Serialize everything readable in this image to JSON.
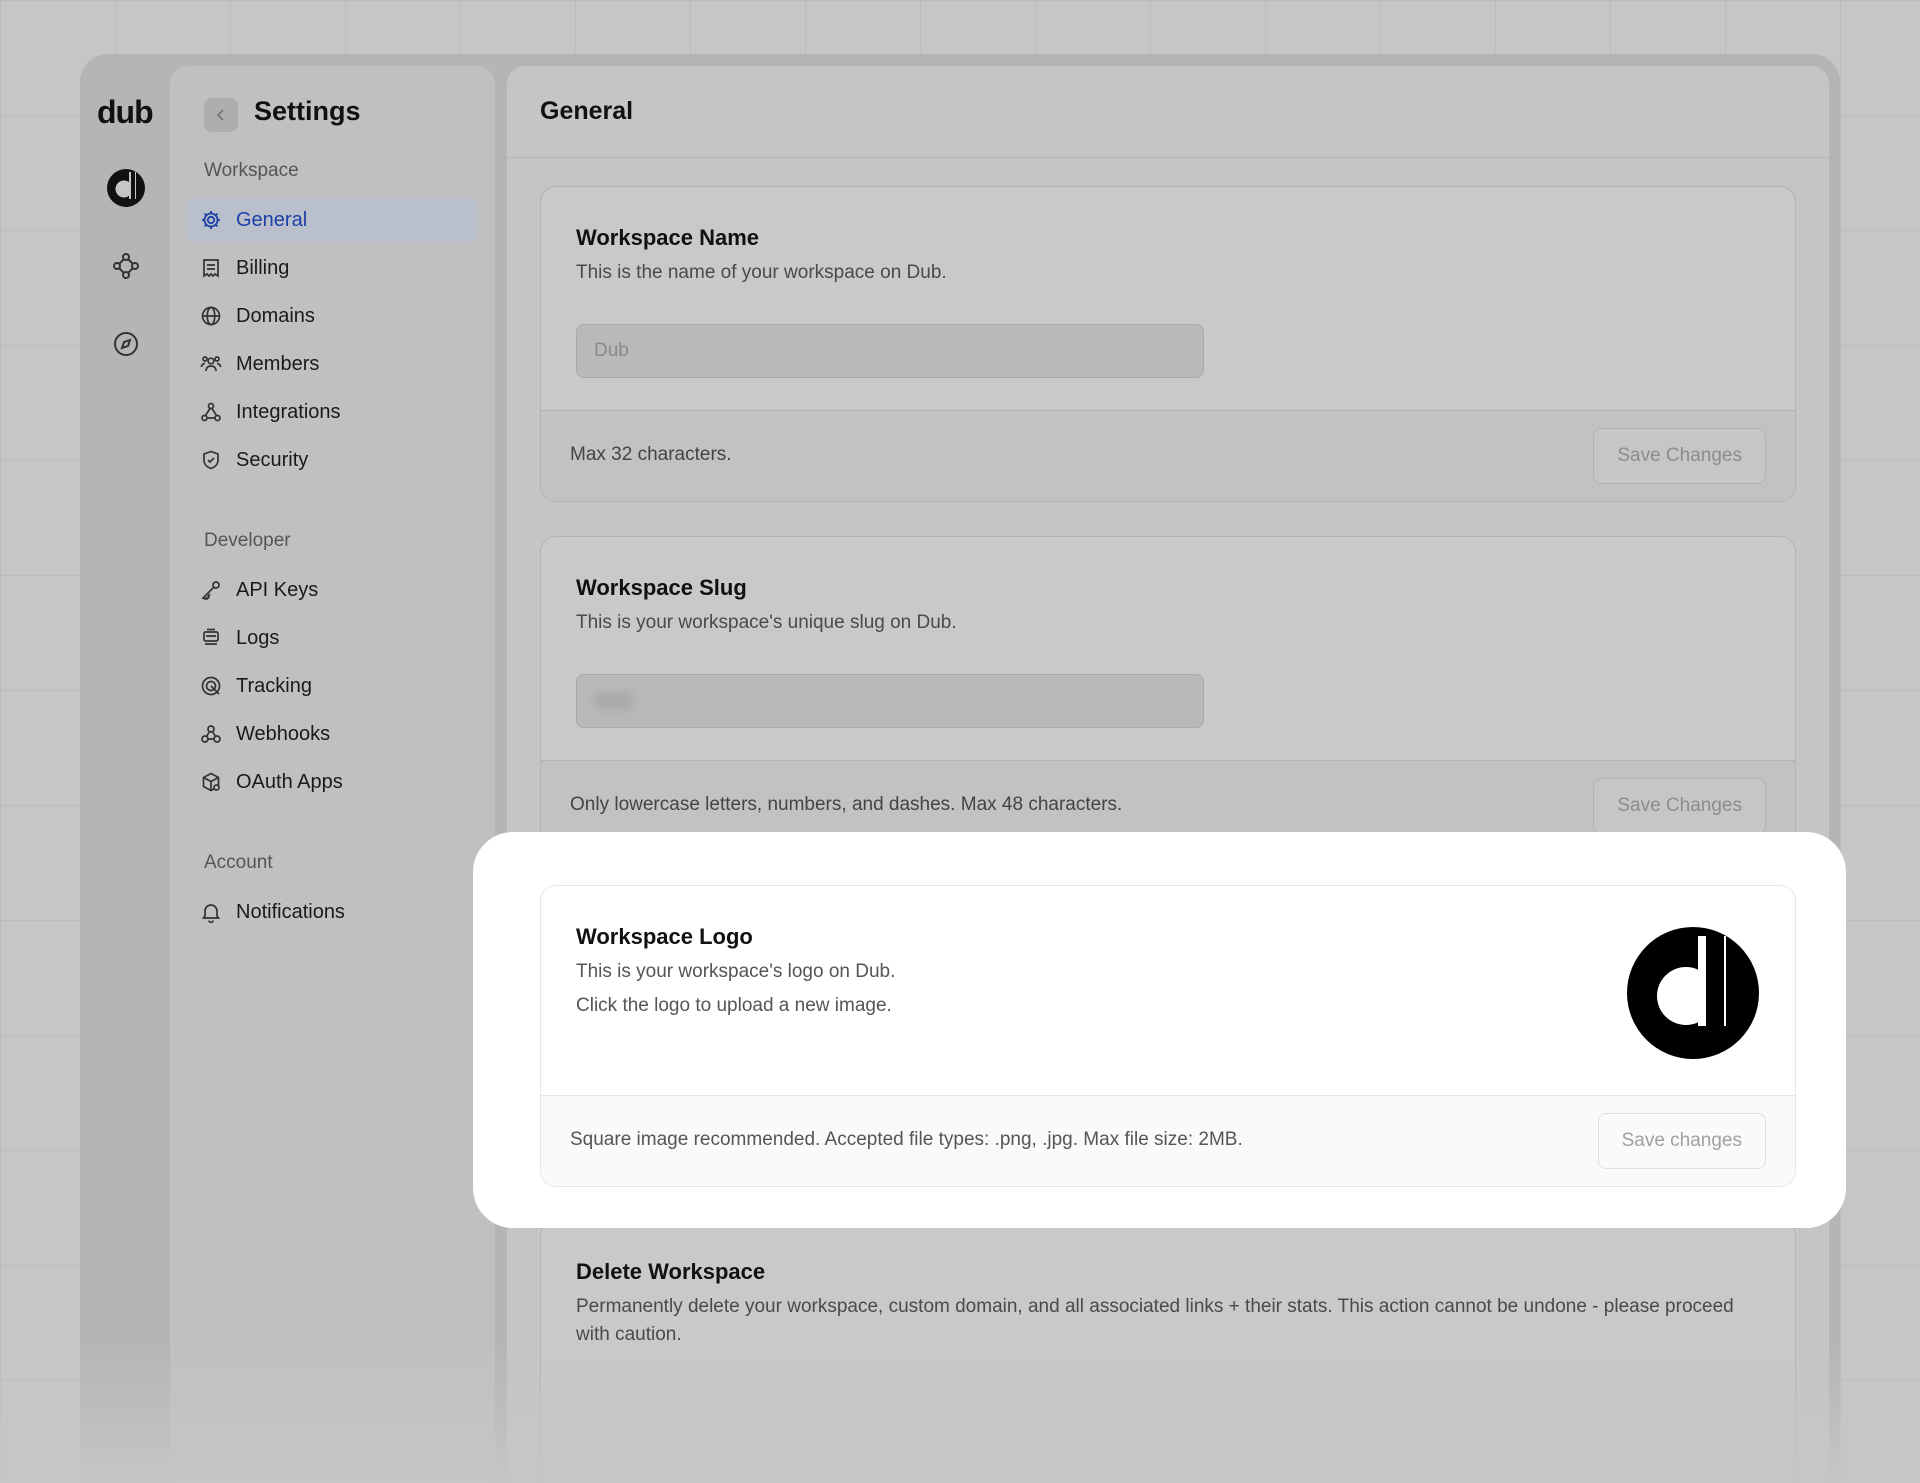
{
  "rail": {
    "brand": "dub",
    "icons": [
      "workspace-logo-icon",
      "graph-icon",
      "compass-icon"
    ]
  },
  "sidebar": {
    "title": "Settings",
    "sections": {
      "workspace": {
        "label": "Workspace",
        "items": [
          {
            "label": "General",
            "icon": "gear-icon",
            "active": true
          },
          {
            "label": "Billing",
            "icon": "receipt-icon"
          },
          {
            "label": "Domains",
            "icon": "globe-icon"
          },
          {
            "label": "Members",
            "icon": "users-icon"
          },
          {
            "label": "Integrations",
            "icon": "integrations-icon"
          },
          {
            "label": "Security",
            "icon": "shield-icon"
          }
        ]
      },
      "developer": {
        "label": "Developer",
        "items": [
          {
            "label": "API Keys",
            "icon": "key-icon"
          },
          {
            "label": "Logs",
            "icon": "logs-icon"
          },
          {
            "label": "Tracking",
            "icon": "target-icon"
          },
          {
            "label": "Webhooks",
            "icon": "webhook-icon"
          },
          {
            "label": "OAuth Apps",
            "icon": "cube-icon"
          }
        ]
      },
      "account": {
        "label": "Account",
        "items": [
          {
            "label": "Notifications",
            "icon": "bell-icon"
          }
        ]
      }
    }
  },
  "main": {
    "title": "General",
    "cards": {
      "name": {
        "title": "Workspace Name",
        "description": "This is the name of your workspace on Dub.",
        "value": "Dub",
        "footer": "Max 32 characters.",
        "button": "Save Changes"
      },
      "slug": {
        "title": "Workspace Slug",
        "description": "This is your workspace's unique slug on Dub.",
        "footer": "Only lowercase letters, numbers, and dashes. Max 48 characters.",
        "button": "Save Changes"
      },
      "logo": {
        "title": "Workspace Logo",
        "description_1": "This is your workspace's logo on Dub.",
        "description_2": "Click the logo to upload a new image.",
        "footer": "Square image recommended. Accepted file types: .png, .jpg. Max file size: 2MB.",
        "button": "Save changes"
      },
      "delete": {
        "title": "Delete Workspace",
        "description": "Permanently delete your workspace, custom domain, and all associated links + their stats. This action cannot be undone - please proceed with caution."
      }
    }
  },
  "colors": {
    "accent": "#1d3fa8",
    "highlight": "#ffffff",
    "overlay": "#c6c6c6"
  }
}
